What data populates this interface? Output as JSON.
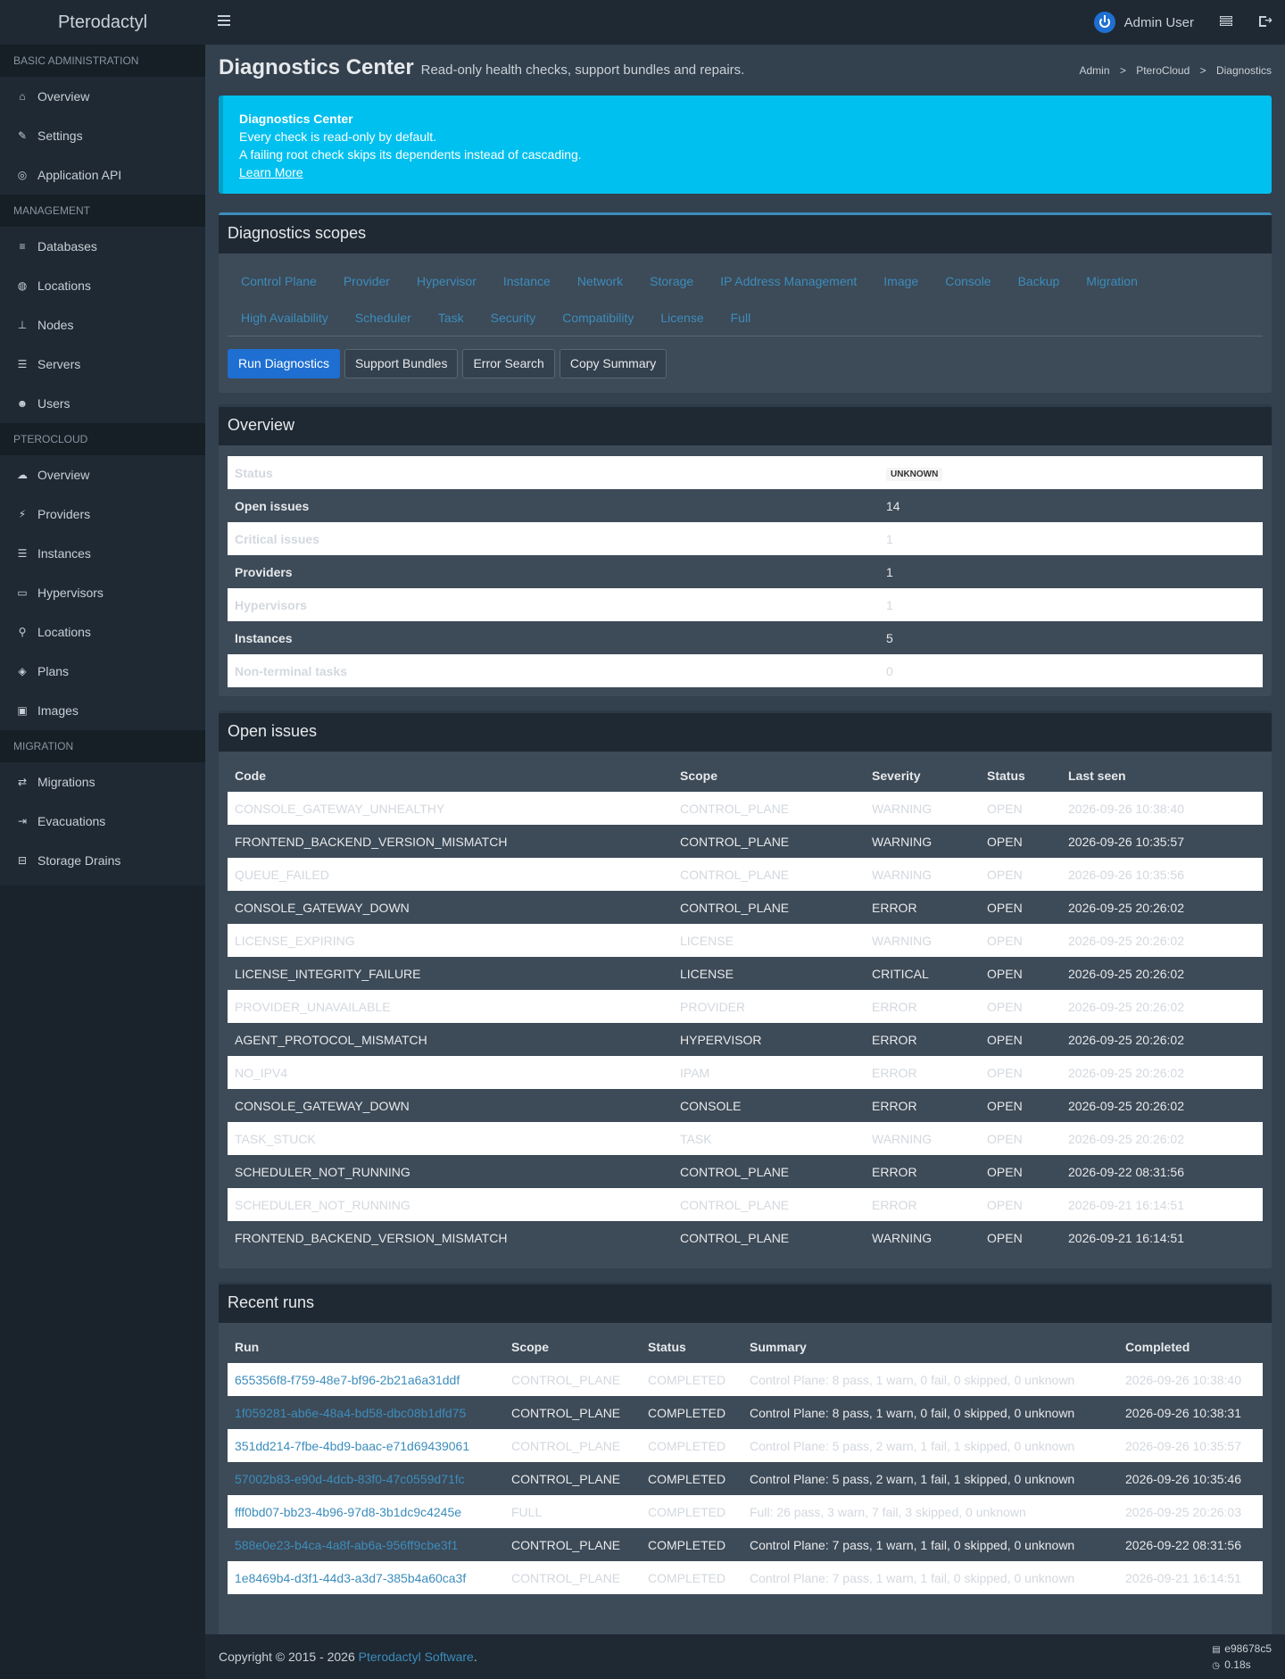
{
  "app": {
    "name": "Pterodactyl",
    "user": "Admin User"
  },
  "sidebar": {
    "sections": [
      {
        "title": "BASIC ADMINISTRATION",
        "items": [
          {
            "label": "Overview",
            "icon": "home-icon"
          },
          {
            "label": "Settings",
            "icon": "wrench-icon"
          },
          {
            "label": "Application API",
            "icon": "gamepad-icon"
          }
        ]
      },
      {
        "title": "MANAGEMENT",
        "items": [
          {
            "label": "Databases",
            "icon": "database-icon"
          },
          {
            "label": "Locations",
            "icon": "globe-icon"
          },
          {
            "label": "Nodes",
            "icon": "sitemap-icon"
          },
          {
            "label": "Servers",
            "icon": "server-icon"
          },
          {
            "label": "Users",
            "icon": "users-icon"
          }
        ]
      },
      {
        "title": "PTEROCLOUD",
        "items": [
          {
            "label": "Overview",
            "icon": "cloud-icon"
          },
          {
            "label": "Providers",
            "icon": "plug-icon"
          },
          {
            "label": "Instances",
            "icon": "server-icon"
          },
          {
            "label": "Hypervisors",
            "icon": "desktop-icon"
          },
          {
            "label": "Locations",
            "icon": "map-marker-icon"
          },
          {
            "label": "Plans",
            "icon": "cube-icon"
          },
          {
            "label": "Images",
            "icon": "image-icon"
          }
        ]
      },
      {
        "title": "MIGRATION",
        "items": [
          {
            "label": "Migrations",
            "icon": "exchange-icon"
          },
          {
            "label": "Evacuations",
            "icon": "sign-out-icon"
          },
          {
            "label": "Storage Drains",
            "icon": "hdd-icon"
          }
        ]
      }
    ]
  },
  "header": {
    "title": "Diagnostics Center",
    "subtitle": "Read-only health checks, support bundles and repairs.",
    "breadcrumb": [
      "Admin",
      "PteroCloud",
      "Diagnostics"
    ],
    "breadcrumb_sep": ">"
  },
  "callout": {
    "title": "Diagnostics Center",
    "line1": "Every check is read-only by default.",
    "line2": "A failing root check skips its dependents instead of cascading.",
    "link": "Learn More"
  },
  "scopes": {
    "title": "Diagnostics scopes",
    "row1": [
      "Control Plane",
      "Provider",
      "Hypervisor",
      "Instance",
      "Network",
      "Storage",
      "IP Address Management",
      "Image",
      "Console",
      "Backup",
      "Migration"
    ],
    "row2": [
      "High Availability",
      "Scheduler",
      "Task",
      "Security",
      "Compatibility",
      "License",
      "Full"
    ],
    "buttons": {
      "run": "Run Diagnostics",
      "bundles": "Support Bundles",
      "search": "Error Search",
      "copy": "Copy Summary"
    }
  },
  "overview": {
    "title": "Overview",
    "rows": [
      {
        "label": "Status",
        "value": "UNKNOWN",
        "badge": true
      },
      {
        "label": "Open issues",
        "value": "14"
      },
      {
        "label": "Critical issues",
        "value": "1"
      },
      {
        "label": "Providers",
        "value": "1"
      },
      {
        "label": "Hypervisors",
        "value": "1"
      },
      {
        "label": "Instances",
        "value": "5"
      },
      {
        "label": "Non-terminal tasks",
        "value": "0"
      }
    ]
  },
  "issues": {
    "title": "Open issues",
    "columns": [
      "Code",
      "Scope",
      "Severity",
      "Status",
      "Last seen"
    ],
    "rows": [
      [
        "CONSOLE_GATEWAY_UNHEALTHY",
        "CONTROL_PLANE",
        "WARNING",
        "OPEN",
        "2026-09-26 10:38:40"
      ],
      [
        "FRONTEND_BACKEND_VERSION_MISMATCH",
        "CONTROL_PLANE",
        "WARNING",
        "OPEN",
        "2026-09-26 10:35:57"
      ],
      [
        "QUEUE_FAILED",
        "CONTROL_PLANE",
        "WARNING",
        "OPEN",
        "2026-09-26 10:35:56"
      ],
      [
        "CONSOLE_GATEWAY_DOWN",
        "CONTROL_PLANE",
        "ERROR",
        "OPEN",
        "2026-09-25 20:26:02"
      ],
      [
        "LICENSE_EXPIRING",
        "LICENSE",
        "WARNING",
        "OPEN",
        "2026-09-25 20:26:02"
      ],
      [
        "LICENSE_INTEGRITY_FAILURE",
        "LICENSE",
        "CRITICAL",
        "OPEN",
        "2026-09-25 20:26:02"
      ],
      [
        "PROVIDER_UNAVAILABLE",
        "PROVIDER",
        "ERROR",
        "OPEN",
        "2026-09-25 20:26:02"
      ],
      [
        "AGENT_PROTOCOL_MISMATCH",
        "HYPERVISOR",
        "ERROR",
        "OPEN",
        "2026-09-25 20:26:02"
      ],
      [
        "NO_IPV4",
        "IPAM",
        "ERROR",
        "OPEN",
        "2026-09-25 20:26:02"
      ],
      [
        "CONSOLE_GATEWAY_DOWN",
        "CONSOLE",
        "ERROR",
        "OPEN",
        "2026-09-25 20:26:02"
      ],
      [
        "TASK_STUCK",
        "TASK",
        "WARNING",
        "OPEN",
        "2026-09-25 20:26:02"
      ],
      [
        "SCHEDULER_NOT_RUNNING",
        "CONTROL_PLANE",
        "ERROR",
        "OPEN",
        "2026-09-22 08:31:56"
      ],
      [
        "SCHEDULER_NOT_RUNNING",
        "CONTROL_PLANE",
        "ERROR",
        "OPEN",
        "2026-09-21 16:14:51"
      ],
      [
        "FRONTEND_BACKEND_VERSION_MISMATCH",
        "CONTROL_PLANE",
        "WARNING",
        "OPEN",
        "2026-09-21 16:14:51"
      ]
    ]
  },
  "runs": {
    "title": "Recent runs",
    "columns": [
      "Run",
      "Scope",
      "Status",
      "Summary",
      "Completed"
    ],
    "rows": [
      [
        "655356f8-f759-48e7-bf96-2b21a6a31ddf",
        "CONTROL_PLANE",
        "COMPLETED",
        "Control Plane: 8 pass, 1 warn, 0 fail, 0 skipped, 0 unknown",
        "2026-09-26 10:38:40"
      ],
      [
        "1f059281-ab6e-48a4-bd58-dbc08b1dfd75",
        "CONTROL_PLANE",
        "COMPLETED",
        "Control Plane: 8 pass, 1 warn, 0 fail, 0 skipped, 0 unknown",
        "2026-09-26 10:38:31"
      ],
      [
        "351dd214-7fbe-4bd9-baac-e71d69439061",
        "CONTROL_PLANE",
        "COMPLETED",
        "Control Plane: 5 pass, 2 warn, 1 fail, 1 skipped, 0 unknown",
        "2026-09-26 10:35:57"
      ],
      [
        "57002b83-e90d-4dcb-83f0-47c0559d71fc",
        "CONTROL_PLANE",
        "COMPLETED",
        "Control Plane: 5 pass, 2 warn, 1 fail, 1 skipped, 0 unknown",
        "2026-09-26 10:35:46"
      ],
      [
        "fff0bd07-bb23-4b96-97d8-3b1dc9c4245e",
        "FULL",
        "COMPLETED",
        "Full: 26 pass, 3 warn, 7 fail, 3 skipped, 0 unknown",
        "2026-09-25 20:26:03"
      ],
      [
        "588e0e23-b4ca-4a8f-ab6a-956ff9cbe3f1",
        "CONTROL_PLANE",
        "COMPLETED",
        "Control Plane: 7 pass, 1 warn, 1 fail, 0 skipped, 0 unknown",
        "2026-09-22 08:31:56"
      ],
      [
        "1e8469b4-d3f1-44d3-a3d7-385b4a60ca3f",
        "CONTROL_PLANE",
        "COMPLETED",
        "Control Plane: 7 pass, 1 warn, 1 fail, 0 skipped, 0 unknown",
        "2026-09-21 16:14:51"
      ]
    ]
  },
  "footer": {
    "copyright": "Copyright © 2015 - 2026",
    "link": "Pterodactyl Software",
    "suffix": ".",
    "version": "e98678c5",
    "time": "0.18s"
  },
  "colors": {
    "accent": "#3c8dbc",
    "primary": "#1e6fd1",
    "callout": "#00c0ef",
    "sidebar": "#1f2933",
    "content": "#33404d"
  }
}
